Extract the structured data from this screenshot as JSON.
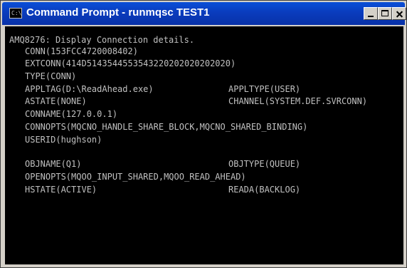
{
  "window": {
    "title": "Command Prompt - runmqsc TEST1",
    "icon": "cmd-icon",
    "icon_text": "C:\\",
    "controls": [
      "minimize-icon",
      "maximize-icon",
      "close-icon"
    ]
  },
  "console": {
    "heading": "AMQ8276: Display Connection details.",
    "conn": "CONN(153FCC4720008402)",
    "extconn": "EXTCONN(414D5143544553543220202020202020)",
    "type": "TYPE(CONN)",
    "appltag": "APPLTAG(D:\\ReadAhead.exe)",
    "appltype": "APPLTYPE(USER)",
    "astate": "ASTATE(NONE)",
    "channel": "CHANNEL(SYSTEM.DEF.SVRCONN)",
    "conname": "CONNAME(127.0.0.1)",
    "connopts": "CONNOPTS(MQCNO_HANDLE_SHARE_BLOCK,MQCNO_SHARED_BINDING)",
    "userid": "USERID(hughson)",
    "objname": "OBJNAME(Q1)",
    "objtype": "OBJTYPE(QUEUE)",
    "openopts": "OPENOPTS(MQOO_INPUT_SHARED,MQOO_READ_AHEAD)",
    "hstate": "HSTATE(ACTIVE)",
    "reada": "READA(BACKLOG)"
  },
  "colors": {
    "titlebar": "#0a3cbd",
    "console_bg": "#000000",
    "console_text": "#c0c0c0"
  }
}
